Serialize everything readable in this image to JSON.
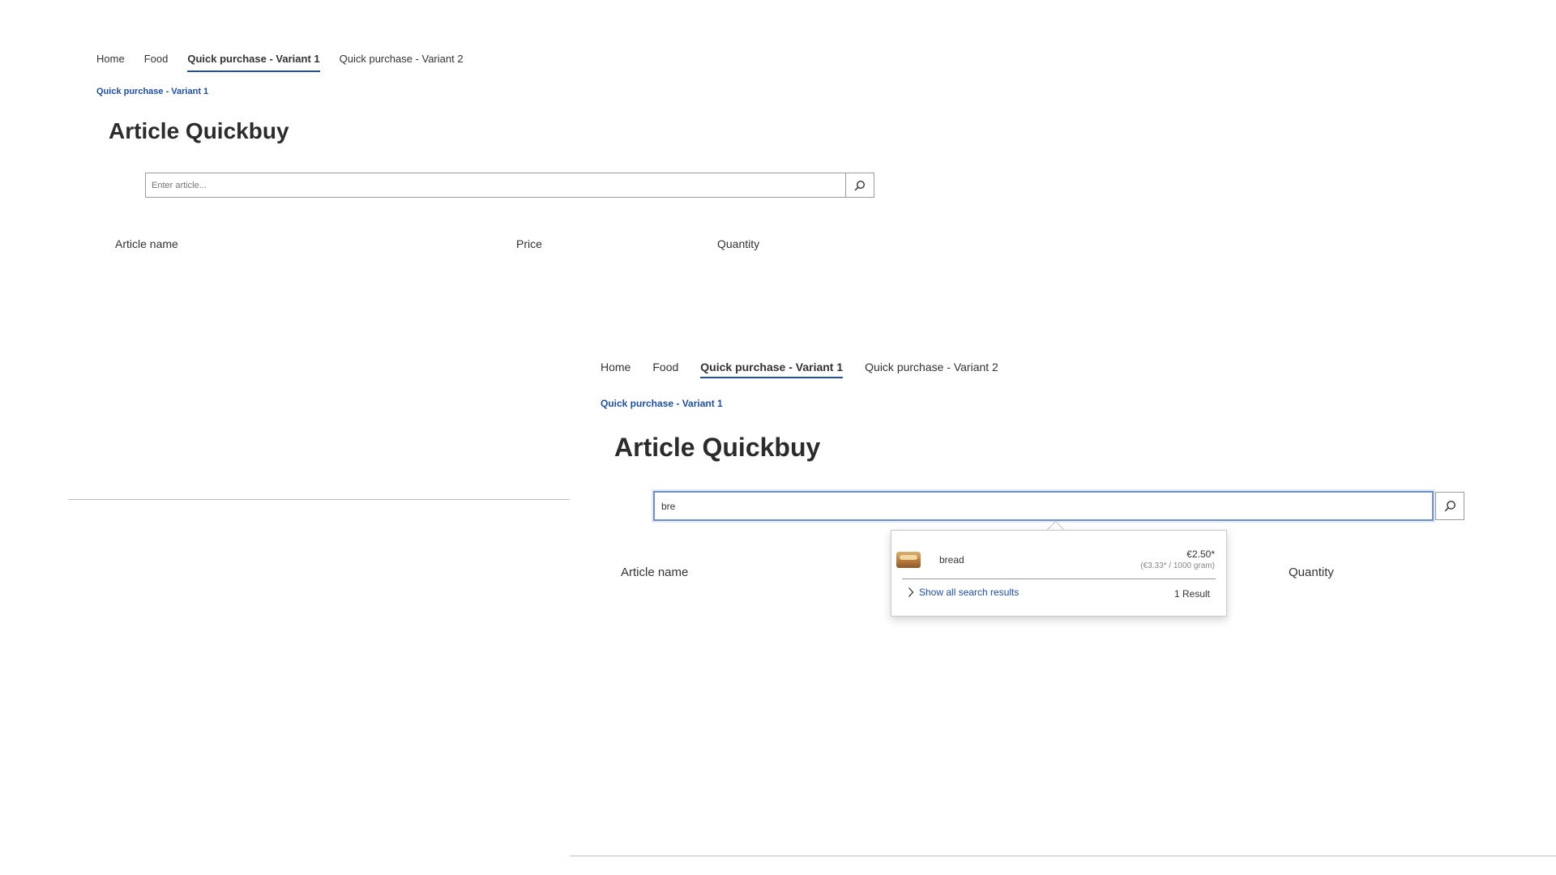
{
  "panel_small": {
    "nav": [
      "Home",
      "Food",
      "Quick purchase - Variant 1",
      "Quick purchase - Variant 2"
    ],
    "breadcrumb": "Quick purchase - Variant 1",
    "title": "Article Quickbuy",
    "search": {
      "placeholder": "Enter article...",
      "value": ""
    },
    "table_headers": {
      "name": "Article name",
      "price": "Price",
      "quantity": "Quantity"
    }
  },
  "panel_large": {
    "nav": [
      "Home",
      "Food",
      "Quick purchase - Variant 1",
      "Quick purchase - Variant 2"
    ],
    "breadcrumb": "Quick purchase - Variant 1",
    "title": "Article Quickbuy",
    "search": {
      "placeholder": "Enter article...",
      "value": "bre"
    },
    "table_headers": {
      "name": "Article name",
      "quantity": "Quantity"
    },
    "suggestions": {
      "results": [
        {
          "name": "bread",
          "price": "€2.50*",
          "unit_price": "(€3.33* / 1000 gram)"
        }
      ],
      "show_all_label": "Show all search results",
      "result_count": "1 Result"
    }
  },
  "icons": {
    "search": "search-icon",
    "chevron": "chevron-right-icon"
  },
  "colors": {
    "accent": "#1f4fa0",
    "focus_border": "#6f8fc9"
  }
}
